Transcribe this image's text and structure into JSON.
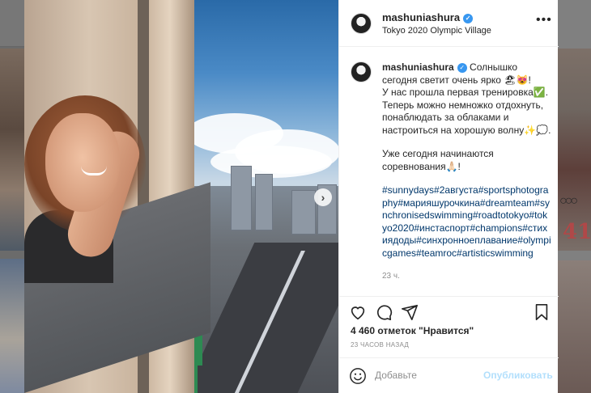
{
  "post": {
    "username": "mashuniashura",
    "location": "Tokyo 2020 Olympic Village",
    "caption_lines": [
      "Солнышко сегодня светит очень ярко 🏖😻!",
      "У нас прошла первая тренировка✅.",
      "Теперь можно немножко отдохнуть, понаблюдать за облаками и настроиться на хорошую волну✨💭."
    ],
    "caption_second": "Уже сегодня начинаются соревнования🙏🏻!",
    "hashtags": "#sunnydays#2августа#sportsphotography#марияшурочкина#dreamteam#synchronisedswimming#roadtotokyo#tokyo2020#инстаспорт#champions#стихиядоды#синхронноеплавание#olympicgames#teamroc#artisticswimming",
    "relative_time": "23 ч.",
    "likes": "4 460 отметок \"Нравится\"",
    "date": "23 ЧАСОВ НАЗАД"
  },
  "comment": {
    "placeholder": "Добавьте",
    "publish_label": "Опубликовать"
  },
  "icons": {
    "verified": "verified-badge-icon",
    "more": "more-options-icon",
    "like": "heart-icon",
    "comment": "comment-icon",
    "share": "send-icon",
    "save": "bookmark-icon",
    "emoji": "emoji-icon",
    "next": "chevron-right-icon"
  },
  "colors": {
    "link": "#00376b",
    "verified": "#3897f0",
    "publish_disabled": "#b2dffc"
  }
}
